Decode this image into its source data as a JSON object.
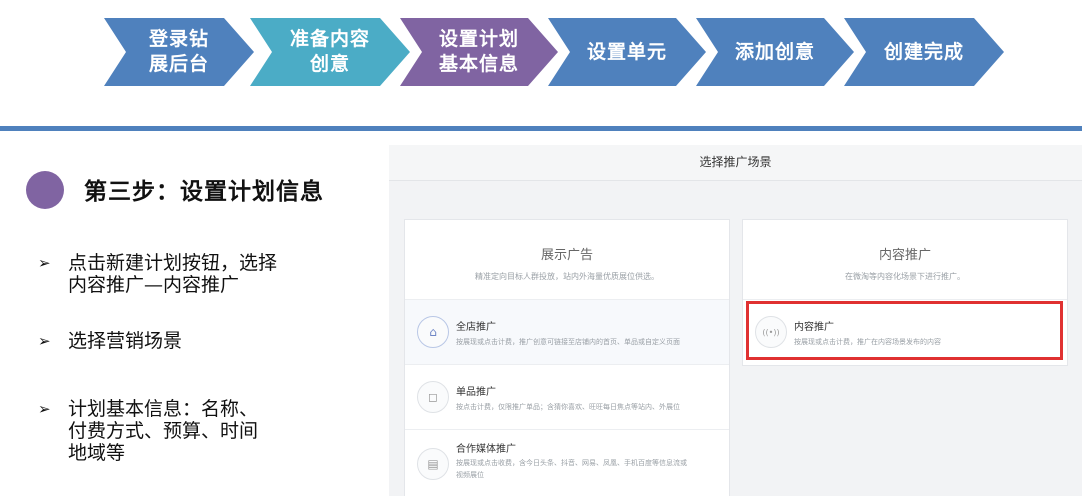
{
  "flow": {
    "steps": [
      {
        "label": "登录钻\n展后台",
        "color": "#4f81bd"
      },
      {
        "label": "准备内容\n创意",
        "color": "#4bacc6"
      },
      {
        "label": "设置计划\n基本信息",
        "color": "#8064a2"
      },
      {
        "label": "设置单元",
        "color": "#4f81bd"
      },
      {
        "label": "添加创意",
        "color": "#4f81bd"
      },
      {
        "label": "创建完成",
        "color": "#4f81bd"
      }
    ]
  },
  "section": {
    "heading": "第三步：设置计划信息",
    "bullets": [
      {
        "mark": "➢",
        "text": "点击新建计划按钮，选择\n内容推广—内容推广"
      },
      {
        "mark": "➢",
        "text": "选择营销场景"
      },
      {
        "mark": "➢",
        "text": "计划基本信息：名称、\n付费方式、预算、时间\n地域等"
      }
    ]
  },
  "screenshot": {
    "title": "选择推广场景",
    "left_card": {
      "title": "展示广告",
      "subtitle": "精准定向目标人群投放，站内外海量优质展位供选。",
      "items": [
        {
          "title": "全店推广",
          "desc": "按展现或点击计费，推广创意可链接至店铺内的首页、单品或自定义页面",
          "icon": "store-icon",
          "glyph": "⌂"
        },
        {
          "title": "单品推广",
          "desc": "按点击计费，仅限推广单品；含猜你喜欢、旺旺每日焦点等站内、外展位",
          "icon": "bag-icon",
          "glyph": "◻"
        },
        {
          "title": "合作媒体推广",
          "desc": "按展现或点击收费，含今日头条、抖音、网易、凤凰、手机百度等信息流或\n视频展位",
          "icon": "calendar-icon",
          "glyph": "▤"
        }
      ]
    },
    "right_card": {
      "title": "内容推广",
      "subtitle": "在微淘等内容化场景下进行推广。",
      "items": [
        {
          "title": "内容推广",
          "desc": "按展现或点击计费，推广在内容场景发布的内容",
          "icon": "broadcast-icon",
          "glyph": "((•))"
        }
      ]
    },
    "highlight_color": "#e03131"
  }
}
